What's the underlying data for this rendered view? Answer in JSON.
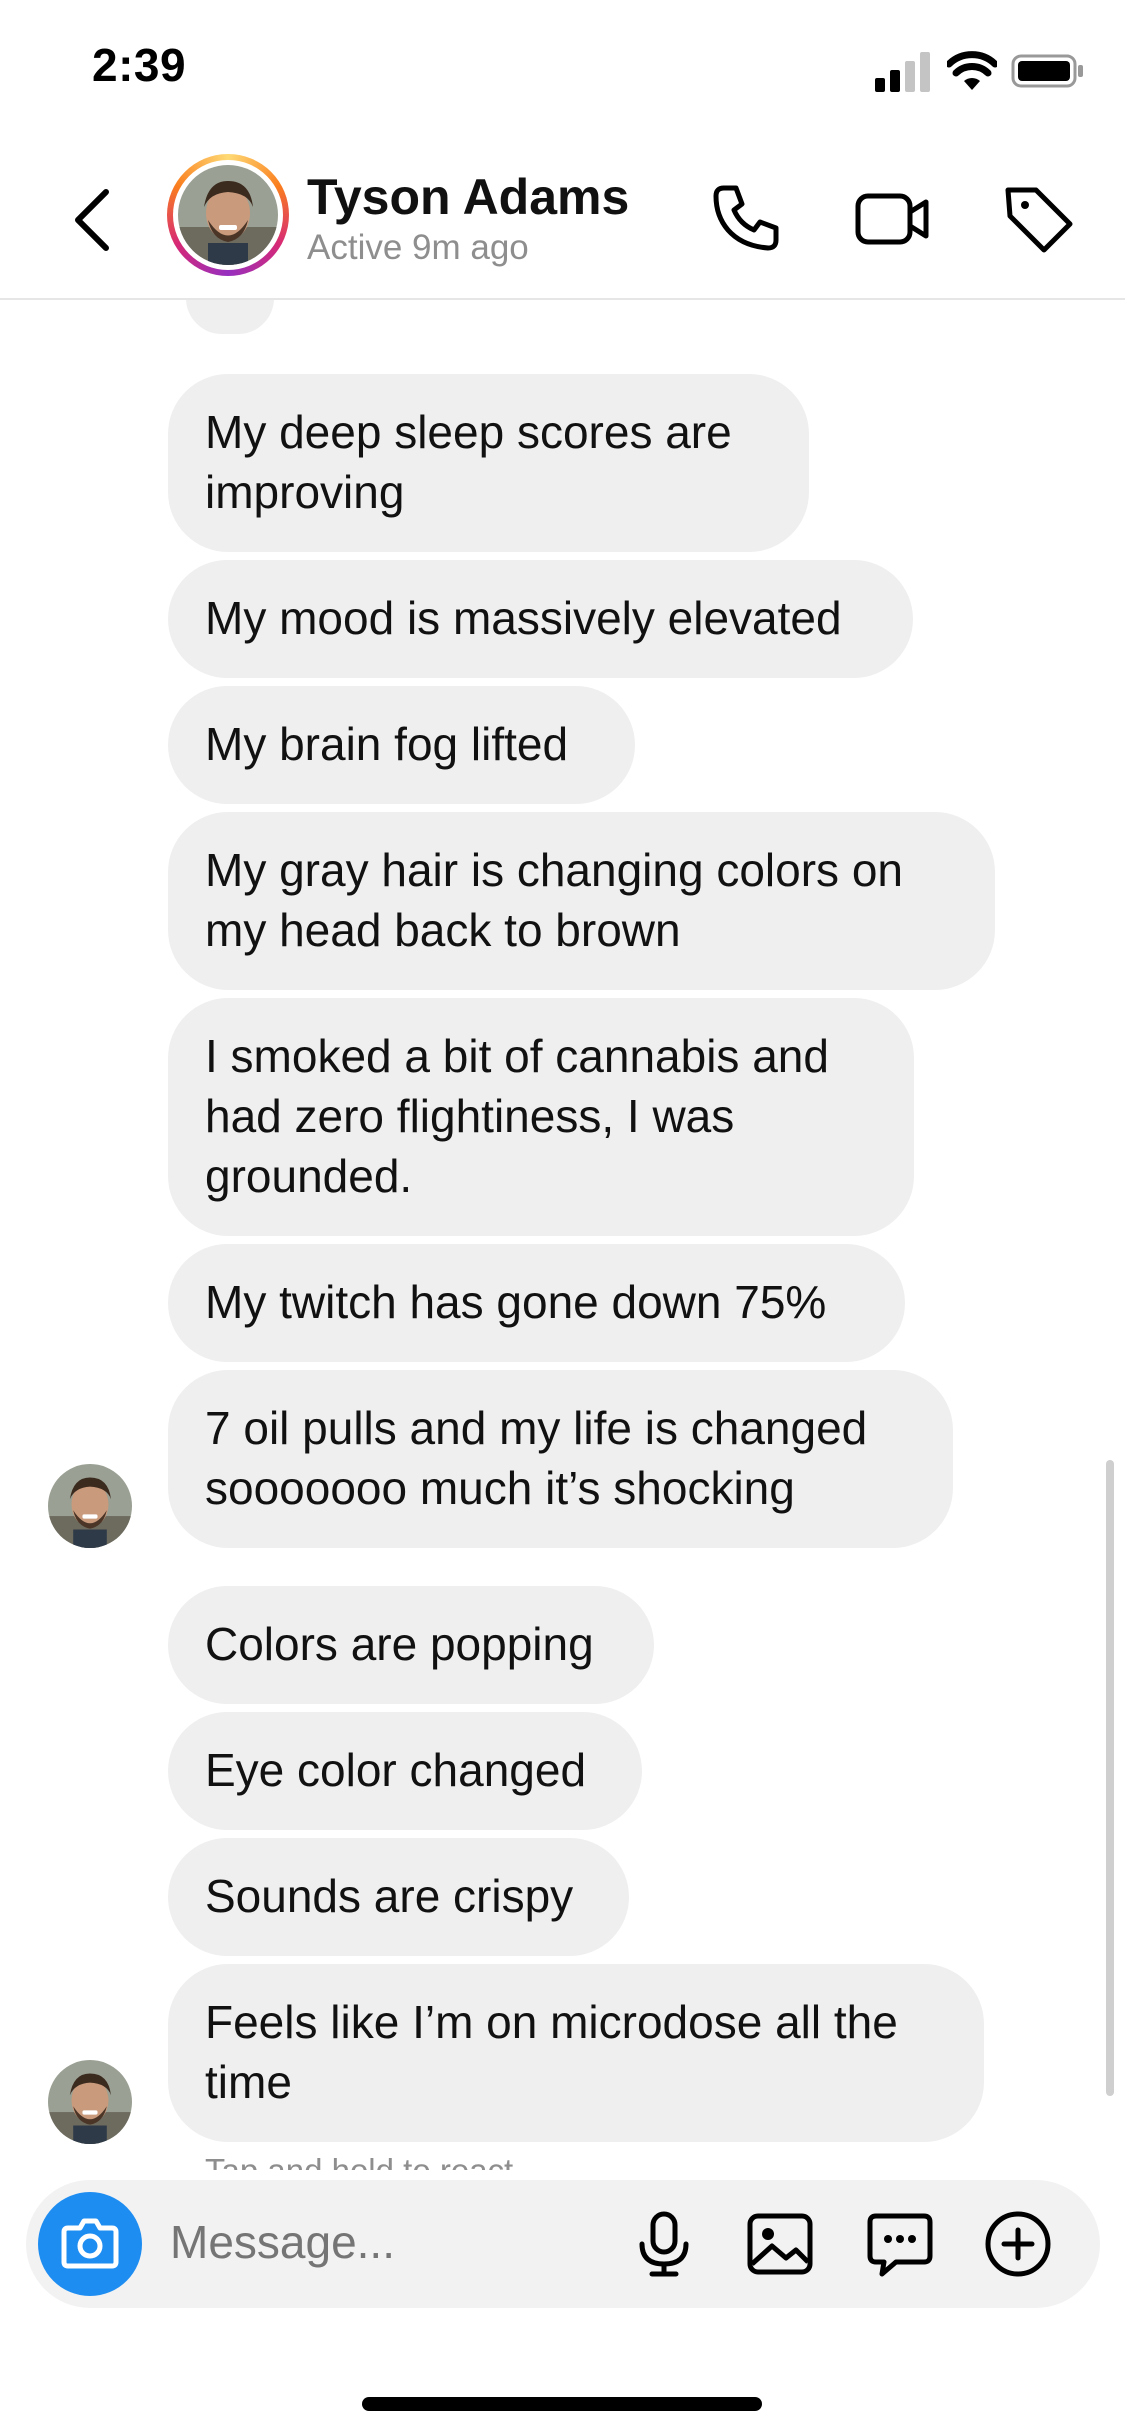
{
  "status_bar": {
    "time": "2:39"
  },
  "header": {
    "contact_name": "Tyson Adams",
    "contact_status": "Active 9m ago"
  },
  "messages": [
    {
      "text": "My deep sleep scores are improving"
    },
    {
      "text": "My mood is massively elevated"
    },
    {
      "text": "My brain fog lifted"
    },
    {
      "text": "My gray hair is changing colors on my head back to brown"
    },
    {
      "text": "I smoked a bit of cannabis and had zero flightiness, I was grounded."
    },
    {
      "text": "My twitch has gone down 75%"
    },
    {
      "text": "7 oil pulls and my life is changed sooooooo much it’s shocking"
    },
    {
      "text": "Colors are popping"
    },
    {
      "text": "Eye color changed"
    },
    {
      "text": "Sounds are crispy"
    },
    {
      "text": "Feels like I’m on microdose all the time"
    }
  ],
  "hint": "Tap and hold to react",
  "composer": {
    "placeholder": "Message..."
  },
  "icons": {
    "back": "back-chevron-icon",
    "call": "phone-icon",
    "video": "video-camera-icon",
    "tag": "tag-icon",
    "camera": "camera-icon",
    "mic": "microphone-icon",
    "gallery": "image-icon",
    "sticker": "chat-bubble-icon",
    "more": "plus-circle-icon"
  },
  "colors": {
    "bubble": "#efefef",
    "camera_button": "#1e8df2",
    "secondary_text": "#8e8e8e",
    "reaction": "#e0242f"
  }
}
